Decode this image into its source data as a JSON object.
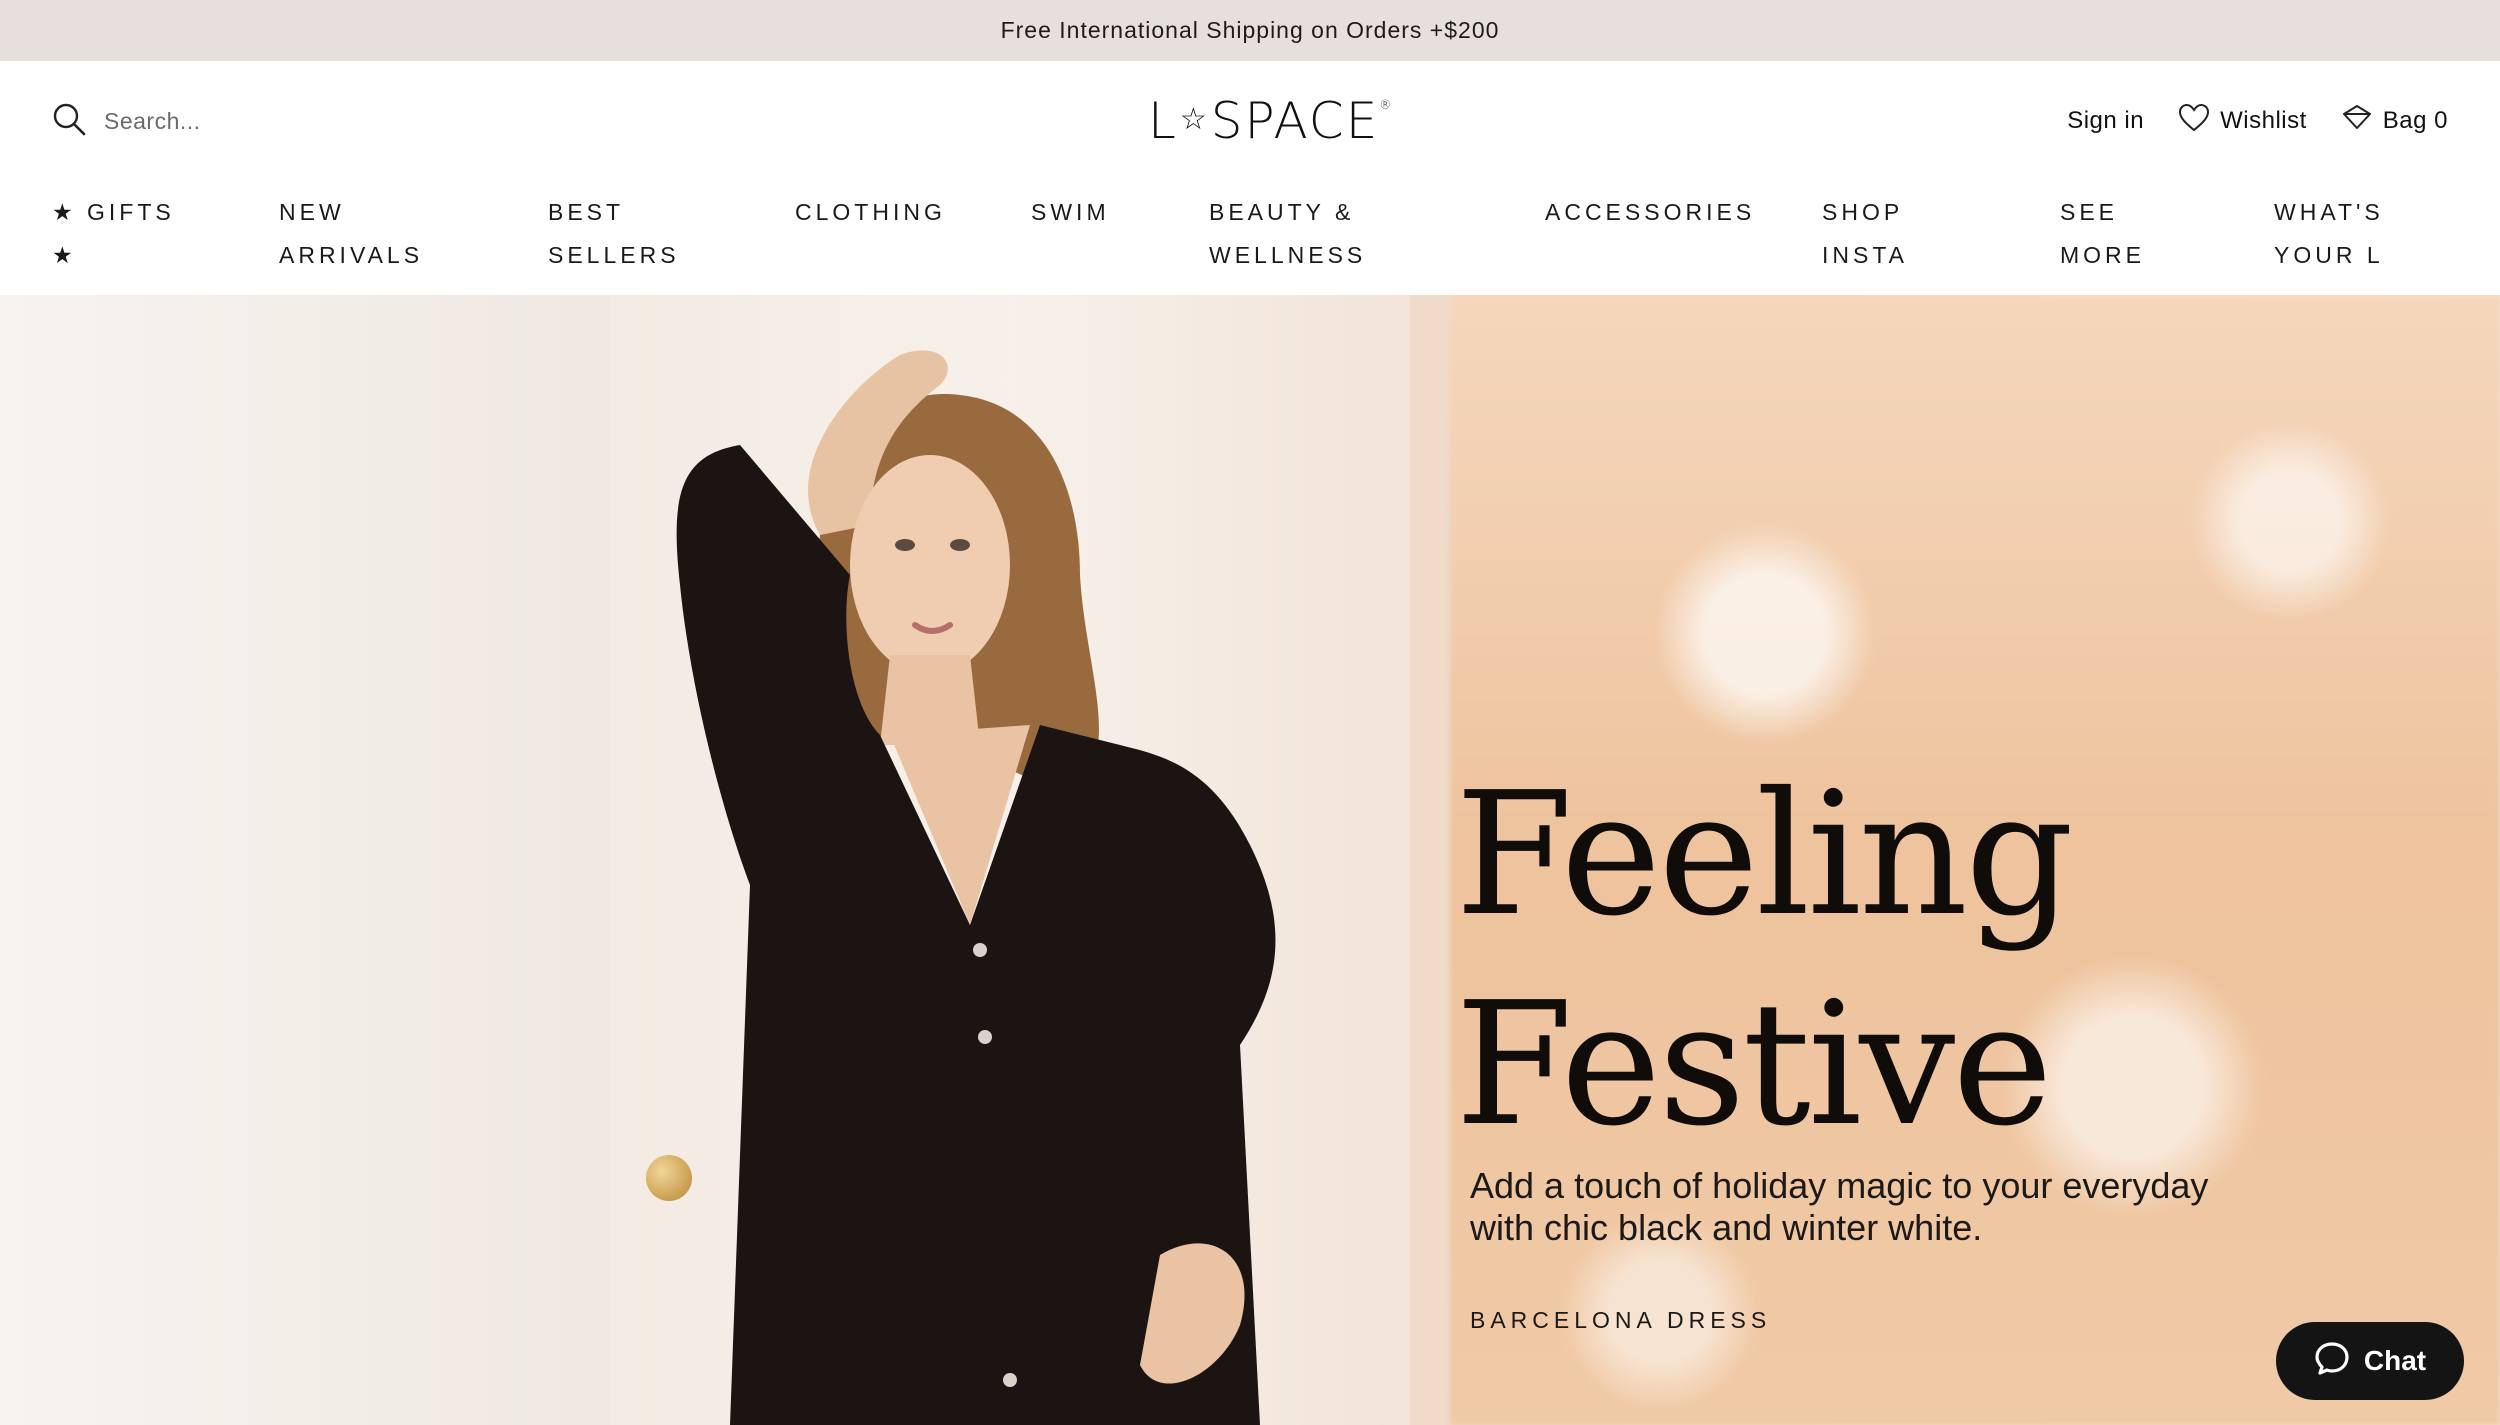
{
  "announcement": {
    "text": "Free International Shipping on Orders +$200"
  },
  "header": {
    "search": {
      "placeholder": "Search..."
    },
    "logo": {
      "left": "L",
      "star": "☆",
      "right": "SPACE",
      "mark": "®"
    },
    "sign_in": "Sign in",
    "wishlist": "Wishlist",
    "bag": "Bag 0"
  },
  "nav": {
    "items": [
      {
        "label": "★ GIFTS\n★"
      },
      {
        "label": "NEW\nARRIVALS"
      },
      {
        "label": "BEST\nSELLERS"
      },
      {
        "label": "CLOTHING"
      },
      {
        "label": "SWIM"
      },
      {
        "label": "BEAUTY &\nWELLNESS"
      },
      {
        "label": "ACCESSORIES"
      },
      {
        "label": "SHOP\nINSTA"
      },
      {
        "label": "SEE\nMORE"
      },
      {
        "label": "WHAT'S\nYOUR L"
      }
    ]
  },
  "hero": {
    "headline": "Feeling\nFestive",
    "subtext": "Add a touch of holiday magic to your everyday with chic black and winter white.",
    "product_link": "BARCELONA DRESS"
  },
  "chat": {
    "label": "Chat"
  },
  "icons": {
    "search": "search-icon",
    "wishlist": "heart-icon",
    "bag": "bag-icon",
    "chat": "chat-bubble-icon"
  }
}
